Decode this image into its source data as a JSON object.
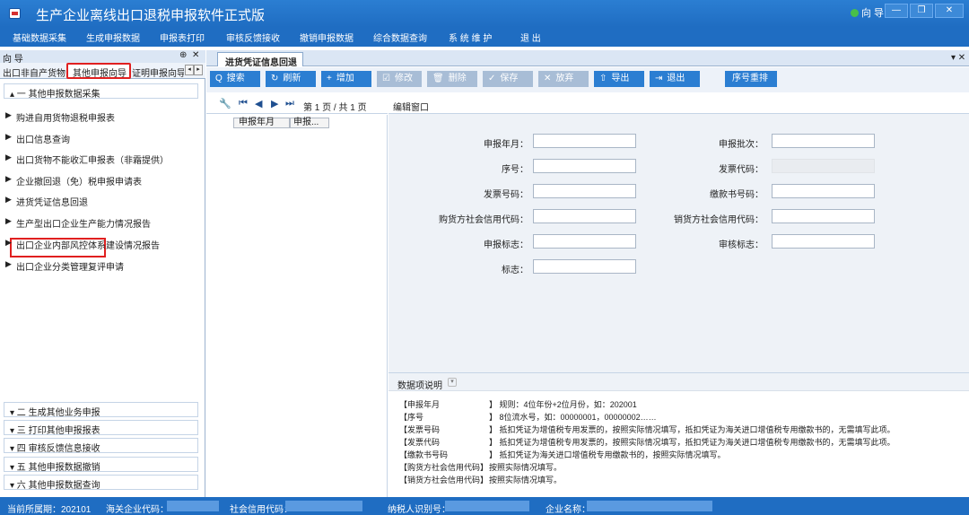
{
  "app": {
    "title": "生产企业离线出口退税申报软件正式版",
    "wizard": "向 导"
  },
  "window_controls": {
    "minimize": "—",
    "restore": "❐",
    "close": "✕"
  },
  "menu": [
    "基础数据采集",
    "生成申报数据",
    "申报表打印",
    "审核反馈接收",
    "撤销申报数据",
    "综合数据查询",
    "系 统 维 护",
    "退 出"
  ],
  "left_panel": {
    "title": "向 导",
    "pin": "⊕",
    "close": "✕",
    "tabs": [
      "出口非自产货物",
      "其他申报向导",
      "证明申报向导"
    ],
    "group1": "▴ 一  其他申报数据采集",
    "items": [
      "购进自用货物退税申报表",
      "出口信息查询",
      "出口货物不能收汇申报表（非霜提供）",
      "企业撤回退（免）税申报申请表",
      "进货凭证信息回退",
      "生产型出口企业生产能力情况报告",
      "出口企业内部风控体系建设情况报告",
      "出口企业分类管理复评申请"
    ],
    "groups": [
      "▾ 二  生成其他业务申报",
      "▾ 三  打印其他申报报表",
      "▾ 四  审核反馈信息接收",
      "▾ 五  其他申报数据撤销",
      "▾ 六  其他申报数据查询"
    ]
  },
  "doc_tab": "进货凭证信息回退",
  "doc_close": "▾ ✕",
  "toolbar": [
    {
      "icon": "Q",
      "label": "搜索"
    },
    {
      "icon": "↻",
      "label": "刷新"
    },
    {
      "icon": "+",
      "label": "增加"
    },
    {
      "icon": "☑",
      "label": "修改"
    },
    {
      "icon": "🗑",
      "label": "删除"
    },
    {
      "icon": "✓",
      "label": "保存"
    },
    {
      "icon": "✕",
      "label": "放弃"
    },
    {
      "icon": "⇧",
      "label": "导出"
    },
    {
      "icon": "⇥",
      "label": "退出"
    },
    {
      "icon": "",
      "label": "序号重排"
    }
  ],
  "pager": {
    "text": "第 1 页 / 共 1 页"
  },
  "grid": {
    "columns": [
      "申报年月",
      "申报..."
    ]
  },
  "edit": {
    "title": "编辑窗口",
    "fields_left": [
      "申报年月：",
      "序号：",
      "发票号码：",
      "购货方社会信用代码：",
      "申报标志：",
      "标志："
    ],
    "fields_right": [
      "申报批次：",
      "发票代码：",
      "缴款书号码：",
      "销货方社会信用代码：",
      "审核标志："
    ]
  },
  "description": {
    "title": "数据项说明",
    "rows": [
      {
        "name": "【申报年月",
        "text": "】 规则：4位年份+2位月份，如：202001"
      },
      {
        "name": "【序号",
        "text": "】 8位流水号，如：00000001，00000002……"
      },
      {
        "name": "【发票号码",
        "text": "】 抵扣凭证为增值税专用发票的，按照实际情况填写，抵扣凭证为海关进口增值税专用缴款书的，无需填写此项。"
      },
      {
        "name": "【发票代码",
        "text": "】 抵扣凭证为增值税专用发票的，按照实际情况填写，抵扣凭证为海关进口增值税专用缴款书的，无需填写此项。"
      },
      {
        "name": "【缴款书号码",
        "text": "】 抵扣凭证为海关进口增值税专用缴款书的，按照实际情况填写。"
      },
      {
        "name": "【购货方社会信用代码】",
        "text": "按照实际情况填写。"
      },
      {
        "name": "【销货方社会信用代码】",
        "text": "按照实际情况填写。"
      }
    ]
  },
  "status": {
    "period": "当前所属期：202101",
    "customs_code": "海关企业代码：",
    "credit_code": "社会信用代码：",
    "taxpayer_id": "纳税人识别号：",
    "company": "企业名称："
  }
}
